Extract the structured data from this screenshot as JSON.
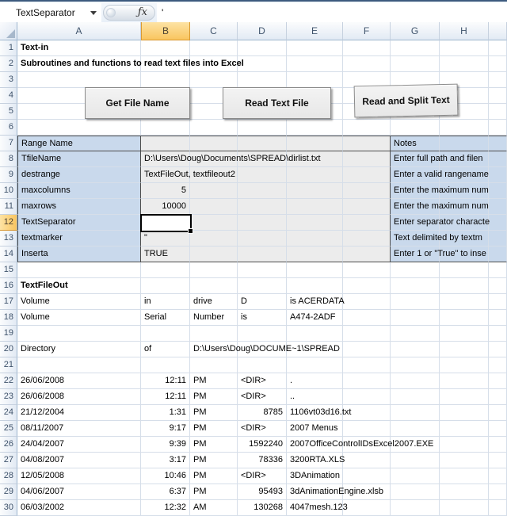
{
  "formula_bar": {
    "name_box": "TextSeparator",
    "fx_label": "ƒx",
    "formula": "'"
  },
  "buttons": [
    {
      "label": "Get File Name"
    },
    {
      "label": "Read Text File"
    },
    {
      "label": "Read and Split Text"
    }
  ],
  "grid": {
    "columns": [
      "A",
      "B",
      "C",
      "D",
      "E",
      "F",
      "G",
      "H",
      ""
    ],
    "row_numbers": [
      1,
      2,
      3,
      4,
      5,
      6,
      7,
      8,
      9,
      10,
      11,
      12,
      13,
      14,
      15,
      16,
      17,
      18,
      19,
      20,
      21,
      22,
      23,
      24,
      25,
      26,
      27,
      28,
      29,
      30
    ],
    "selection": {
      "cell": "B12",
      "row": 12,
      "col": "B"
    },
    "colors": {
      "selection_orange": "#F9C55F",
      "range_fill_blue": "#C9D9EC",
      "range_fill_gray": "#ECECEC",
      "grid_line": "#D6DEE9",
      "header_text": "#3F536B"
    },
    "cells": [
      {
        "r": 1,
        "c": "A",
        "t": "Text-in",
        "b": true
      },
      {
        "r": 2,
        "c": "A",
        "t": "Subroutines and functions to read text files into Excel",
        "b": true
      },
      {
        "r": 7,
        "c": "A",
        "t": "Range Name"
      },
      {
        "r": 7,
        "c": "G",
        "t": "Notes"
      },
      {
        "r": 8,
        "c": "A",
        "t": "TfileName"
      },
      {
        "r": 8,
        "c": "B",
        "t": "D:\\Users\\Doug\\Documents\\SPREAD\\dirlist.txt"
      },
      {
        "r": 8,
        "c": "G",
        "t": "Enter full path and filen"
      },
      {
        "r": 9,
        "c": "A",
        "t": "destrange"
      },
      {
        "r": 9,
        "c": "B",
        "t": "TextFileOut, textfileout2"
      },
      {
        "r": 9,
        "c": "G",
        "t": "Enter a valid rangename"
      },
      {
        "r": 10,
        "c": "A",
        "t": "maxcolumns"
      },
      {
        "r": 10,
        "c": "B",
        "t": "5",
        "a": "r"
      },
      {
        "r": 10,
        "c": "G",
        "t": "Enter the maximum num"
      },
      {
        "r": 11,
        "c": "A",
        "t": "maxrows"
      },
      {
        "r": 11,
        "c": "B",
        "t": "10000",
        "a": "r"
      },
      {
        "r": 11,
        "c": "G",
        "t": "Enter the maximum num"
      },
      {
        "r": 12,
        "c": "A",
        "t": "TextSeparator"
      },
      {
        "r": 12,
        "c": "G",
        "t": "Enter separator characte"
      },
      {
        "r": 13,
        "c": "A",
        "t": "textmarker"
      },
      {
        "r": 13,
        "c": "B",
        "t": "\""
      },
      {
        "r": 13,
        "c": "G",
        "t": "Text delimited by textm"
      },
      {
        "r": 14,
        "c": "A",
        "t": "Inserta"
      },
      {
        "r": 14,
        "c": "B",
        "t": "TRUE"
      },
      {
        "r": 14,
        "c": "G",
        "t": "Enter 1 or \"True\" to inse"
      },
      {
        "r": 16,
        "c": "A",
        "t": "TextFileOut",
        "b": true
      },
      {
        "r": 17,
        "c": "A",
        "t": "Volume"
      },
      {
        "r": 17,
        "c": "B",
        "t": "in"
      },
      {
        "r": 17,
        "c": "C",
        "t": "drive"
      },
      {
        "r": 17,
        "c": "D",
        "t": "D"
      },
      {
        "r": 17,
        "c": "E",
        "t": "is ACERDATA"
      },
      {
        "r": 18,
        "c": "A",
        "t": "Volume"
      },
      {
        "r": 18,
        "c": "B",
        "t": "Serial"
      },
      {
        "r": 18,
        "c": "C",
        "t": "Number"
      },
      {
        "r": 18,
        "c": "D",
        "t": "is"
      },
      {
        "r": 18,
        "c": "E",
        "t": "A474-2ADF"
      },
      {
        "r": 20,
        "c": "A",
        "t": "Directory"
      },
      {
        "r": 20,
        "c": "B",
        "t": "of"
      },
      {
        "r": 20,
        "c": "C",
        "t": "D:\\Users\\Doug\\DOCUME~1\\SPREAD"
      },
      {
        "r": 22,
        "c": "A",
        "t": "26/06/2008"
      },
      {
        "r": 22,
        "c": "B",
        "t": "12:11",
        "a": "r"
      },
      {
        "r": 22,
        "c": "C",
        "t": "PM"
      },
      {
        "r": 22,
        "c": "D",
        "t": "<DIR>"
      },
      {
        "r": 22,
        "c": "E",
        "t": "."
      },
      {
        "r": 23,
        "c": "A",
        "t": "26/06/2008"
      },
      {
        "r": 23,
        "c": "B",
        "t": "12:11",
        "a": "r"
      },
      {
        "r": 23,
        "c": "C",
        "t": "PM"
      },
      {
        "r": 23,
        "c": "D",
        "t": "<DIR>"
      },
      {
        "r": 23,
        "c": "E",
        "t": ".."
      },
      {
        "r": 24,
        "c": "A",
        "t": "21/12/2004"
      },
      {
        "r": 24,
        "c": "B",
        "t": "1:31",
        "a": "r"
      },
      {
        "r": 24,
        "c": "C",
        "t": "PM"
      },
      {
        "r": 24,
        "c": "D",
        "t": "8785",
        "a": "r"
      },
      {
        "r": 24,
        "c": "E",
        "t": "1106vt03d16.txt"
      },
      {
        "r": 25,
        "c": "A",
        "t": "08/11/2007"
      },
      {
        "r": 25,
        "c": "B",
        "t": "9:17",
        "a": "r"
      },
      {
        "r": 25,
        "c": "C",
        "t": "PM"
      },
      {
        "r": 25,
        "c": "D",
        "t": "<DIR>"
      },
      {
        "r": 25,
        "c": "E",
        "t": "2007 Menus"
      },
      {
        "r": 26,
        "c": "A",
        "t": "24/04/2007"
      },
      {
        "r": 26,
        "c": "B",
        "t": "9:39",
        "a": "r"
      },
      {
        "r": 26,
        "c": "C",
        "t": "PM"
      },
      {
        "r": 26,
        "c": "D",
        "t": "1592240",
        "a": "r"
      },
      {
        "r": 26,
        "c": "E",
        "t": "2007OfficeControlIDsExcel2007.EXE"
      },
      {
        "r": 27,
        "c": "A",
        "t": "04/08/2007"
      },
      {
        "r": 27,
        "c": "B",
        "t": "3:17",
        "a": "r"
      },
      {
        "r": 27,
        "c": "C",
        "t": "PM"
      },
      {
        "r": 27,
        "c": "D",
        "t": "78336",
        "a": "r"
      },
      {
        "r": 27,
        "c": "E",
        "t": "3200RTA.XLS"
      },
      {
        "r": 28,
        "c": "A",
        "t": "12/05/2008"
      },
      {
        "r": 28,
        "c": "B",
        "t": "10:46",
        "a": "r"
      },
      {
        "r": 28,
        "c": "C",
        "t": "PM"
      },
      {
        "r": 28,
        "c": "D",
        "t": "<DIR>"
      },
      {
        "r": 28,
        "c": "E",
        "t": "3DAnimation"
      },
      {
        "r": 29,
        "c": "A",
        "t": "04/06/2007"
      },
      {
        "r": 29,
        "c": "B",
        "t": "6:37",
        "a": "r"
      },
      {
        "r": 29,
        "c": "C",
        "t": "PM"
      },
      {
        "r": 29,
        "c": "D",
        "t": "95493",
        "a": "r"
      },
      {
        "r": 29,
        "c": "E",
        "t": "3dAnimationEngine.xlsb"
      },
      {
        "r": 30,
        "c": "A",
        "t": "06/03/2002"
      },
      {
        "r": 30,
        "c": "B",
        "t": "12:32",
        "a": "r"
      },
      {
        "r": 30,
        "c": "C",
        "t": "AM"
      },
      {
        "r": 30,
        "c": "D",
        "t": "130268",
        "a": "r"
      },
      {
        "r": 30,
        "c": "E",
        "t": "4047mesh.123"
      }
    ]
  }
}
